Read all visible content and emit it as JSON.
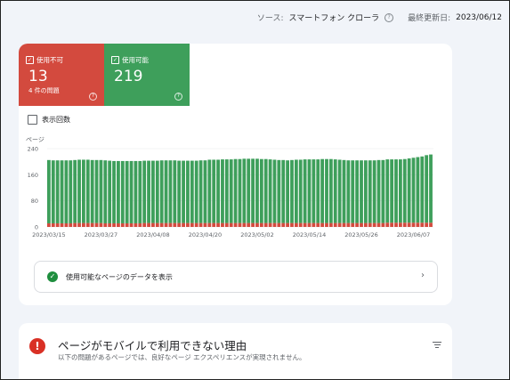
{
  "header": {
    "source_label": "ソース:",
    "source_value": "スマートフォン クローラ",
    "updated_label": "最終更新日:",
    "updated_value": "2023/06/12"
  },
  "tiles": {
    "unusable": {
      "label": "使用不可",
      "value": "13",
      "sub": "4 件の問題",
      "color": "#d34a3e"
    },
    "usable": {
      "label": "使用可能",
      "value": "219",
      "color": "#3e9f5b"
    }
  },
  "impressions_label": "表示回数",
  "chart_data": {
    "type": "bar",
    "stacked": true,
    "ylabel": "ページ",
    "ylim": [
      0,
      240
    ],
    "yticks": [
      0,
      80,
      160,
      240
    ],
    "xtick_labels": [
      "2023/03/15",
      "2023/03/27",
      "2023/04/08",
      "2023/04/20",
      "2023/05/02",
      "2023/05/14",
      "2023/05/26",
      "2023/06/07"
    ],
    "grid": true,
    "colors": {
      "usable": "#3e9f5b",
      "unusable": "#d34a3e"
    },
    "series": [
      {
        "key": "unusable",
        "values": [
          11,
          11,
          11,
          11,
          11,
          11,
          12,
          12,
          12,
          12,
          12,
          12,
          12,
          11,
          11,
          11,
          11,
          11,
          11,
          11,
          11,
          11,
          12,
          12,
          12,
          12,
          12,
          12,
          12,
          12,
          12,
          12,
          12,
          12,
          12,
          12,
          12,
          12,
          12,
          12,
          12,
          12,
          12,
          12,
          12,
          12,
          12,
          12,
          12,
          12,
          12,
          12,
          12,
          12,
          12,
          12,
          12,
          12,
          12,
          12,
          12,
          12,
          12,
          12,
          12,
          12,
          12,
          12,
          12,
          12,
          12,
          12,
          12,
          12,
          12,
          12,
          12,
          12,
          13,
          13,
          13,
          13,
          13,
          13,
          13,
          13,
          13,
          13,
          13
        ]
      },
      {
        "key": "usable",
        "values": [
          194,
          193,
          193,
          193,
          193,
          193,
          193,
          194,
          194,
          194,
          193,
          193,
          193,
          193,
          192,
          191,
          191,
          191,
          191,
          191,
          191,
          191,
          191,
          191,
          191,
          191,
          192,
          192,
          192,
          192,
          191,
          191,
          191,
          191,
          191,
          192,
          192,
          194,
          194,
          194,
          195,
          195,
          195,
          196,
          196,
          197,
          197,
          197,
          197,
          196,
          196,
          195,
          194,
          193,
          193,
          192,
          193,
          194,
          194,
          195,
          195,
          195,
          195,
          196,
          196,
          196,
          195,
          194,
          193,
          192,
          192,
          192,
          192,
          192,
          192,
          192,
          193,
          193,
          194,
          194,
          194,
          194,
          195,
          197,
          199,
          201,
          203,
          207,
          209
        ]
      }
    ]
  },
  "detail_link": {
    "label": "使用可能なページのデータを表示"
  },
  "reason_card": {
    "title": "ページがモバイルで利用できない理由",
    "description": "以下の問題があるページでは、良好なページ エクスペリエンスが実現されません。"
  }
}
